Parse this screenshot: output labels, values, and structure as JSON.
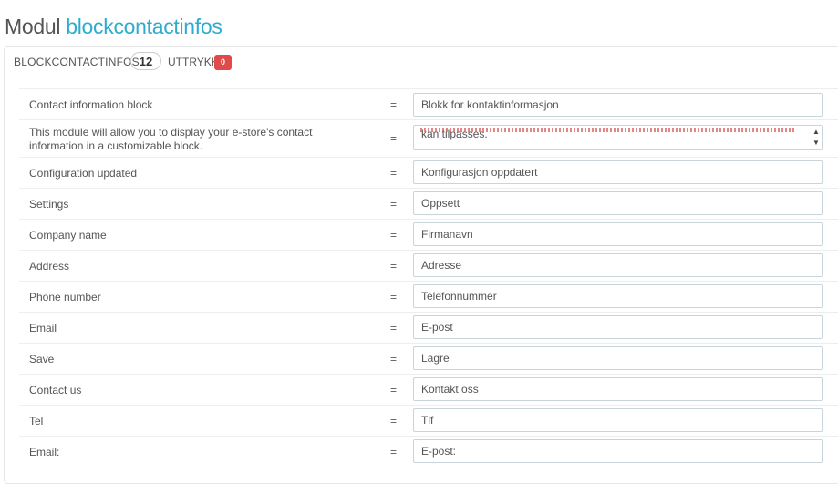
{
  "page": {
    "title_prefix": "Modul",
    "module_name": "blockcontactinfos"
  },
  "panel": {
    "heading": "BLOCKCONTACTINFOS",
    "count": "12",
    "expressions_label": "UTTRYKK",
    "missing_count": "0"
  },
  "rows": [
    {
      "source": "Contact information block",
      "separator": "=",
      "translation": "Blokk for kontaktinformasjon"
    },
    {
      "source": "This module will allow you to display your e-store's contact information in a customizable block.",
      "separator": "=",
      "translation": "kan tilpasses."
    },
    {
      "source": "Configuration updated",
      "separator": "=",
      "translation": "Konfigurasjon oppdatert"
    },
    {
      "source": "Settings",
      "separator": "=",
      "translation": "Oppsett"
    },
    {
      "source": "Company name",
      "separator": "=",
      "translation": "Firmanavn"
    },
    {
      "source": "Address",
      "separator": "=",
      "translation": "Adresse"
    },
    {
      "source": "Phone number",
      "separator": "=",
      "translation": "Telefonnummer"
    },
    {
      "source": "Email",
      "separator": "=",
      "translation": "E-post"
    },
    {
      "source": "Save",
      "separator": "=",
      "translation": "Lagre"
    },
    {
      "source": "Contact us",
      "separator": "=",
      "translation": "Kontakt oss"
    },
    {
      "source": "Tel",
      "separator": "=",
      "translation": "Tlf"
    },
    {
      "source": "Email:",
      "separator": "=",
      "translation": "E-post:"
    }
  ],
  "colors": {
    "accent": "#2eacce",
    "badge": "#e04b4a",
    "text": "#555555",
    "input_border": "#c7d6db"
  }
}
